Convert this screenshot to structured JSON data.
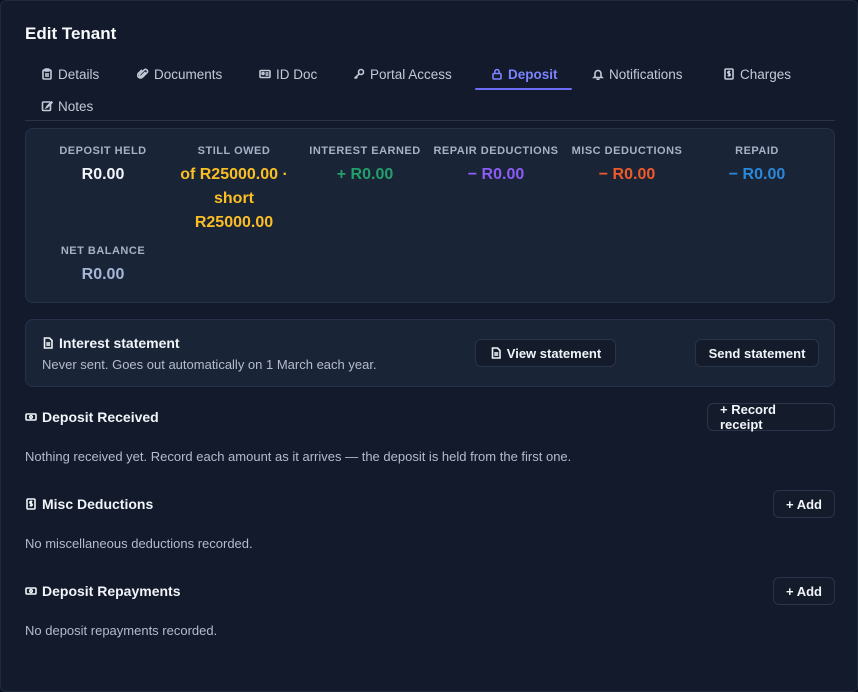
{
  "modal": {
    "title": "Edit Tenant"
  },
  "tabs": [
    {
      "label": "Details",
      "icon": "clipboard-icon"
    },
    {
      "label": "Documents",
      "icon": "paperclip-icon"
    },
    {
      "label": "ID Doc",
      "icon": "id-card-icon"
    },
    {
      "label": "Portal Access",
      "icon": "key-icon"
    },
    {
      "label": "Deposit",
      "icon": "lock-icon",
      "active": true
    },
    {
      "label": "Notifications",
      "icon": "bell-icon"
    },
    {
      "label": "Charges",
      "icon": "invoice-icon"
    },
    {
      "label": "Notes",
      "icon": "edit-icon"
    }
  ],
  "summary": {
    "deposit_held": {
      "label": "DEPOSIT HELD",
      "value": "R0.00",
      "color": "#f1f5f9"
    },
    "still_owed": {
      "label": "STILL OWED",
      "value": "of R25000.00 · short R25000.00",
      "color": "#fbbf24"
    },
    "interest_earned": {
      "label": "INTEREST EARNED",
      "value": "+ R0.00",
      "color": "#22a06b"
    },
    "repair_deductions": {
      "label": "REPAIR DEDUCTIONS",
      "value": "− R0.00",
      "color": "#8b5cf6"
    },
    "misc_deductions": {
      "label": "MISC DEDUCTIONS",
      "value": "− R0.00",
      "color": "#f0592a"
    },
    "repaid": {
      "label": "REPAID",
      "value": "− R0.00",
      "color": "#2b87d9"
    },
    "net_balance": {
      "label": "NET BALANCE",
      "value": "R0.00",
      "color": "#a7b6d6"
    }
  },
  "interest_statement": {
    "title": "Interest statement",
    "subtitle": "Never sent. Goes out automatically on 1 March each year.",
    "view_label": "View statement",
    "send_label": "Send statement"
  },
  "deposit_received": {
    "title": "Deposit Received",
    "button_label": "+ Record receipt",
    "empty_text": "Nothing received yet. Record each amount as it arrives — the deposit is held from the first one."
  },
  "misc_deductions": {
    "title": "Misc Deductions",
    "button_label": "+ Add",
    "empty_text": "No miscellaneous deductions recorded."
  },
  "deposit_repayments": {
    "title": "Deposit Repayments",
    "button_label": "+ Add",
    "empty_text": "No deposit repayments recorded."
  }
}
